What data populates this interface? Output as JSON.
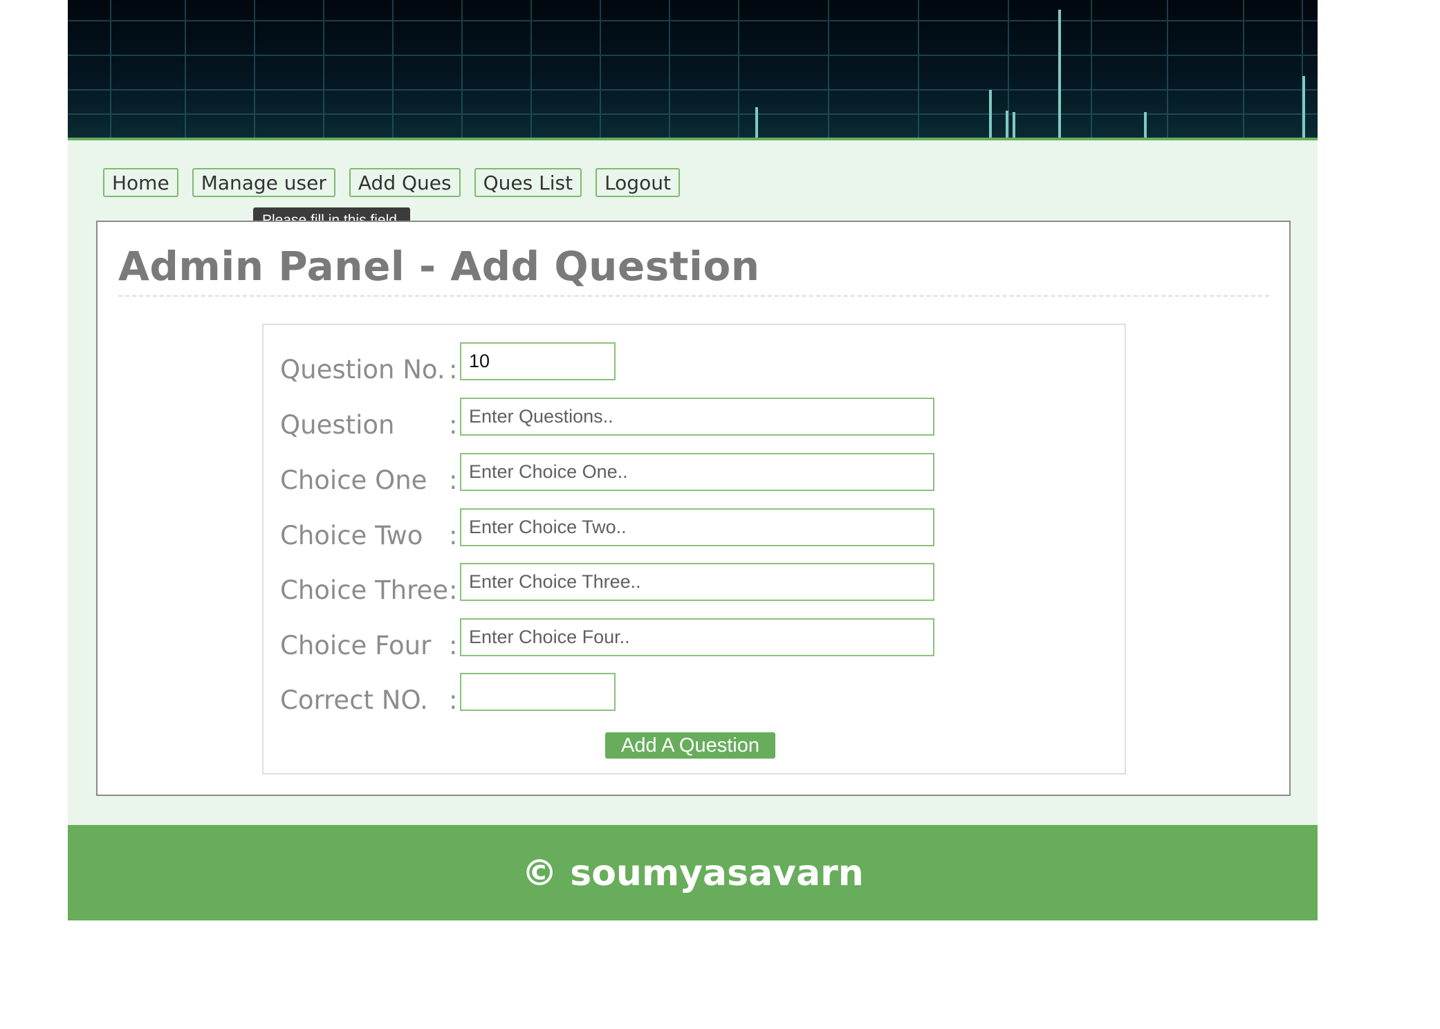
{
  "nav": {
    "items": [
      {
        "label": "Home"
      },
      {
        "label": "Manage user"
      },
      {
        "label": "Add Ques"
      },
      {
        "label": "Ques List"
      },
      {
        "label": "Logout"
      }
    ]
  },
  "tooltip": "Please fill in this field.",
  "panel": {
    "title": "Admin Panel - Add Question"
  },
  "form": {
    "colon": ":",
    "fields": [
      {
        "label": "Question No.",
        "value": "10",
        "placeholder": ""
      },
      {
        "label": "Question",
        "value": "",
        "placeholder": "Enter Questions.."
      },
      {
        "label": "Choice One",
        "value": "",
        "placeholder": "Enter Choice One.."
      },
      {
        "label": "Choice Two",
        "value": "",
        "placeholder": "Enter Choice Two.."
      },
      {
        "label": "Choice Three",
        "value": "",
        "placeholder": "Enter Choice Three.."
      },
      {
        "label": "Choice Four",
        "value": "",
        "placeholder": "Enter Choice Four.."
      },
      {
        "label": "Correct NO.",
        "value": "",
        "placeholder": ""
      }
    ],
    "submit_label": "Add A Question"
  },
  "footer": {
    "text": "© soumyasavarn"
  },
  "colors": {
    "accent": "#67ad5b",
    "main_bg": "#eaf5ec",
    "banner": "#041520"
  }
}
